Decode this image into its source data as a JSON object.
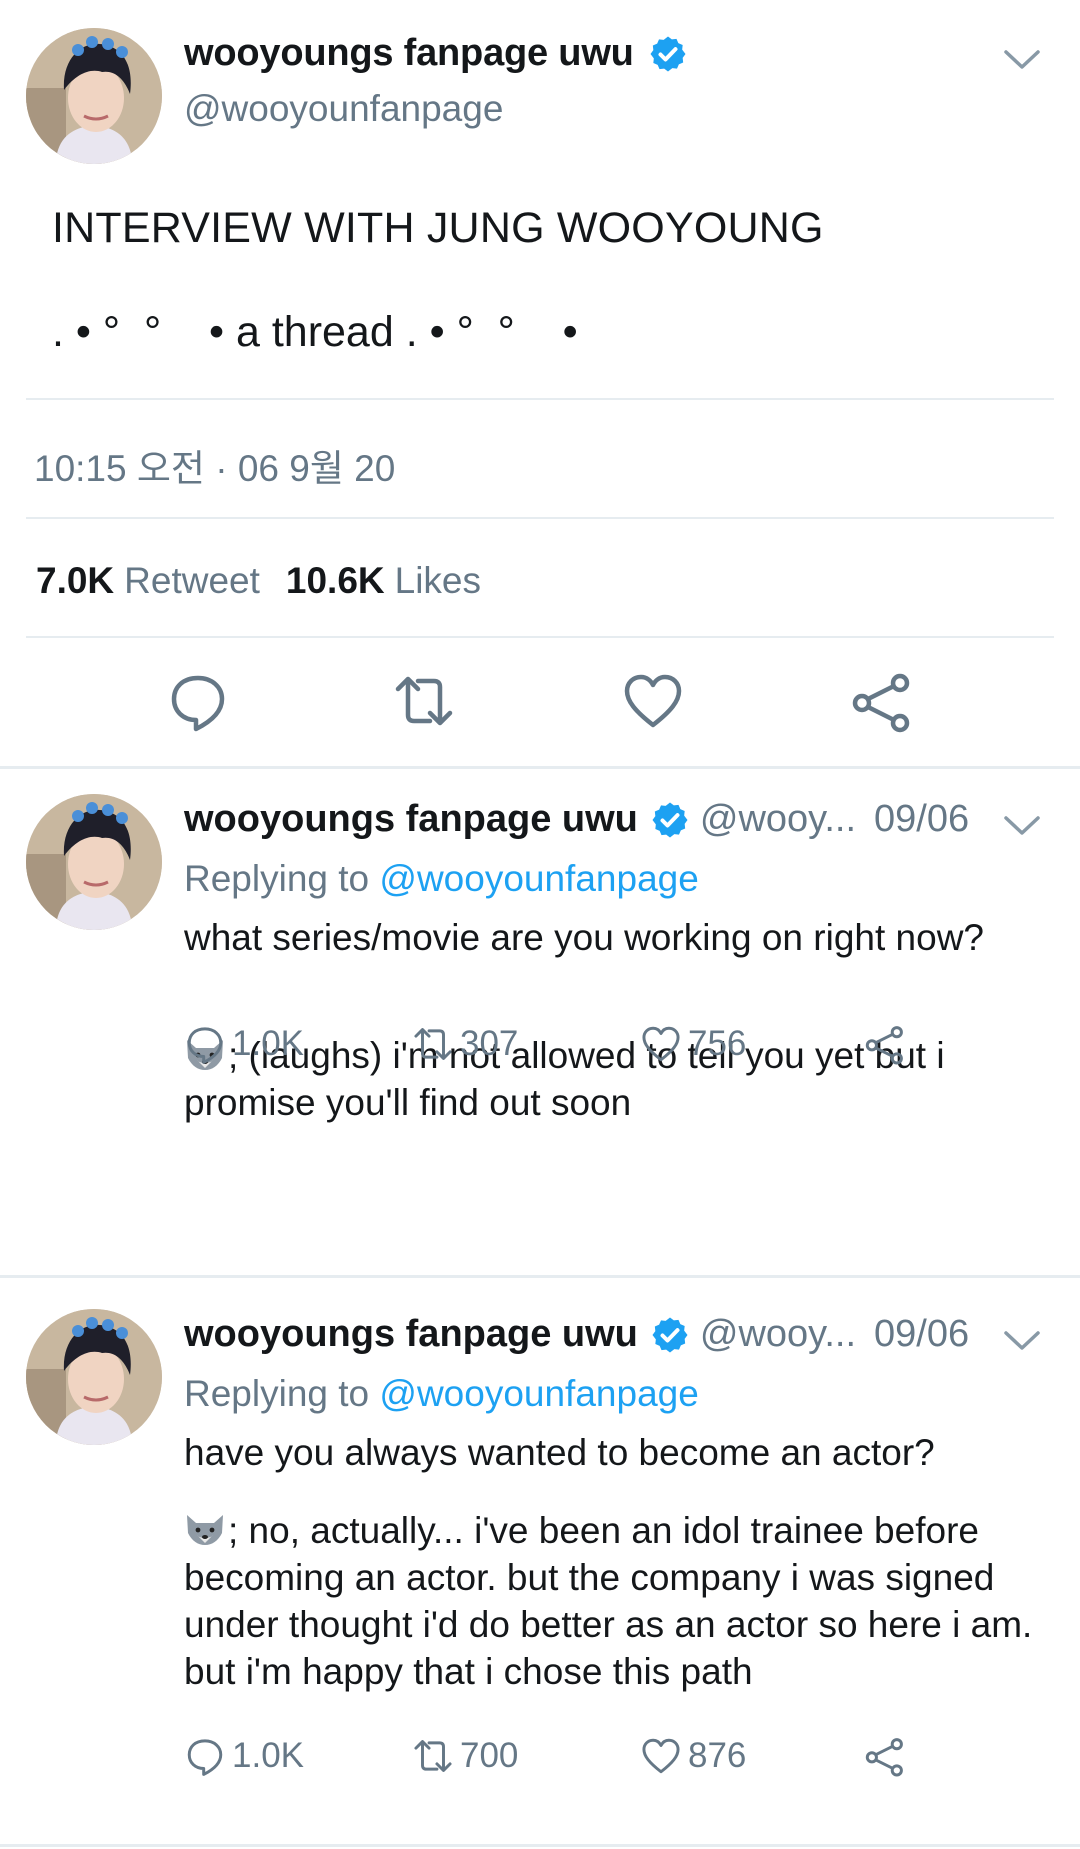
{
  "main_tweet": {
    "display_name": "wooyoungs fanpage uwu",
    "handle": "@wooyounfanpage",
    "text": "INTERVIEW WITH JUNG WOOYOUNG",
    "thread_line": ". • °  °    • a thread . • °  °    •",
    "timestamp": "10:15 오전 · 06 9월 20",
    "retweets_count": "7.0K",
    "retweets_label": "Retweet",
    "likes_count": "10.6K",
    "likes_label": "Likes"
  },
  "replies": [
    {
      "display_name": "wooyoungs fanpage uwu",
      "handle": "@wooy...",
      "date": "09/06",
      "replying_prefix": "Replying to",
      "replying_to": "@wooyounfanpage",
      "question": "what series/movie are you working on right now?",
      "answer": "; (laughs) i'm not allowed to tell you yet but i promise you'll find out soon",
      "reply_count": "1.0K",
      "retweet_count": "307",
      "like_count": "756"
    },
    {
      "display_name": "wooyoungs fanpage uwu",
      "handle": "@wooy...",
      "date": "09/06",
      "replying_prefix": "Replying to",
      "replying_to": "@wooyounfanpage",
      "question": "have you always wanted to become an actor?",
      "answer": "; no, actually... i've been an idol trainee before becoming an actor. but the company i was signed under thought i'd do better as an actor so here i am. but i'm happy that i chose this path",
      "reply_count": "1.0K",
      "retweet_count": "700",
      "like_count": "876"
    }
  ],
  "icons": {
    "verified": "verified-badge-icon",
    "caret": "chevron-down-icon",
    "reply": "reply-icon",
    "retweet": "retweet-icon",
    "like": "heart-icon",
    "share": "share-icon",
    "emoji": "wolf-emoji-icon"
  },
  "colors": {
    "text": "#14171a",
    "secondary": "#657786",
    "accent": "#1da1f2",
    "divider": "#e6ecf0"
  }
}
